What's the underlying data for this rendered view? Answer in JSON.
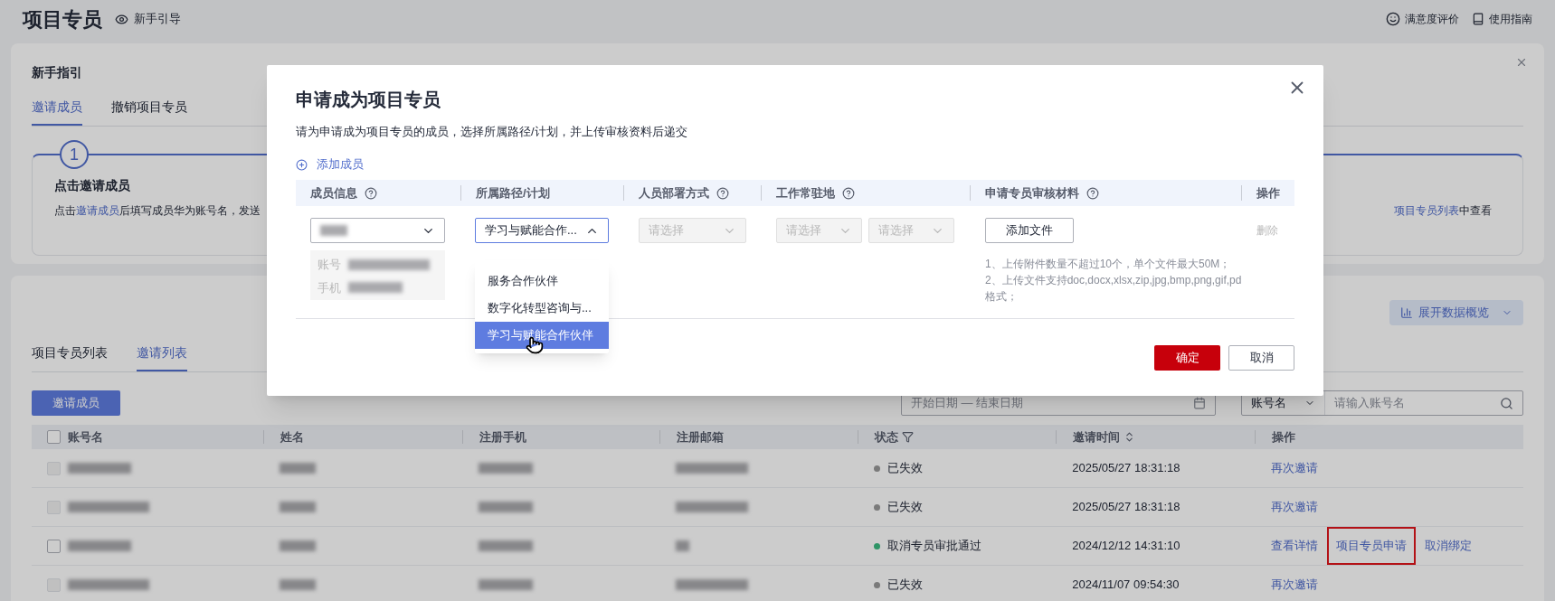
{
  "header": {
    "title": "项目专员",
    "guide_link": "新手引导",
    "right_links": [
      {
        "kind": "smile",
        "label": "满意度评价"
      },
      {
        "kind": "book",
        "label": "使用指南"
      }
    ]
  },
  "guide_card": {
    "title": "新手指引",
    "tabs": [
      {
        "label": "邀请成员",
        "selected": true
      },
      {
        "label": "撤销项目专员",
        "selected": false
      }
    ],
    "step": {
      "number": "1",
      "title": "点击邀请成员",
      "desc_before": "点击",
      "desc_link": "邀请成员",
      "desc_after": "后填写成员华为账号名，发送",
      "tail_link": "项目专员列表",
      "tail_after": "中查看"
    }
  },
  "list_card": {
    "overview_button": "展开数据概览",
    "tabs": [
      {
        "label": "项目专员列表",
        "selected": false
      },
      {
        "label": "邀请列表",
        "selected": true
      }
    ],
    "invite_button": "邀请成员",
    "date_range": {
      "placeholder": "开始日期 — 结束日期"
    },
    "search_type": "账号名",
    "search": {
      "placeholder": "请输入账号名"
    },
    "columns": [
      {
        "label": "账号名",
        "kind": "checkbox",
        "checked": false
      },
      {
        "label": "姓名",
        "kind": "plain"
      },
      {
        "label": "注册手机",
        "kind": "plain"
      },
      {
        "label": "注册邮箱",
        "kind": "plain"
      },
      {
        "label": "状态",
        "kind": "filter"
      },
      {
        "label": "邀请时间",
        "kind": "sort"
      },
      {
        "label": "操作",
        "kind": "plain"
      }
    ],
    "rows": [
      {
        "checkbox_disabled": true,
        "status": "已失效",
        "color": "#7a7a7a",
        "time": "2025/05/27 18:31:18",
        "actions": [
          {
            "label": "再次邀请",
            "highlighted": false
          }
        ]
      },
      {
        "checkbox_disabled": true,
        "status": "已失效",
        "color": "#7a7a7a",
        "time": "2025/05/27 18:31:18",
        "actions": [
          {
            "label": "再次邀请",
            "highlighted": false
          }
        ]
      },
      {
        "checkbox_disabled": false,
        "status": "取消专员审批通过",
        "color": "#2f9466",
        "time": "2024/12/12 14:31:10",
        "actions": [
          {
            "label": "查看详情",
            "highlighted": false
          },
          {
            "label": "项目专员申请",
            "highlighted": true
          },
          {
            "label": "取消绑定",
            "highlighted": false
          }
        ]
      },
      {
        "checkbox_disabled": true,
        "status": "已失效",
        "color": "#7a7a7a",
        "time": "2024/11/07 09:54:30",
        "actions": [
          {
            "label": "再次邀请",
            "highlighted": false
          }
        ]
      }
    ]
  },
  "dialog": {
    "title": "申请成为项目专员",
    "subtitle": "请为申请成为项目专员的成员，选择所属路径/计划，并上传审核资料后递交",
    "add_member": "添加成员",
    "columns": [
      {
        "label": "成员信息",
        "kind": "help"
      },
      {
        "label": "所属路径/计划",
        "kind": "plain"
      },
      {
        "label": "人员部署方式",
        "kind": "help"
      },
      {
        "label": "工作常驻地",
        "kind": "help"
      },
      {
        "label": "申请专员审核材料",
        "kind": "help"
      },
      {
        "label": "操作",
        "kind": "plain"
      }
    ],
    "row": {
      "account_label": "账号",
      "phone_label": "手机",
      "path_select": {
        "value": "学习与赋能合作...",
        "open": true,
        "options": [
          {
            "label": "服务合作伙伴",
            "selected": false
          },
          {
            "label": "数字化转型咨询与...",
            "selected": false
          },
          {
            "label": "学习与赋能合作伙伴",
            "selected": true
          }
        ]
      },
      "deploy_select": {
        "placeholder": "请选择",
        "disabled": true
      },
      "location_selects": [
        {
          "placeholder": "请选择",
          "disabled": true
        },
        {
          "placeholder": "请选择",
          "disabled": true
        }
      ],
      "add_file": "添加文件",
      "hints": [
        "1、上传附件数量不超过10个，单个文件最大50M；",
        "2、上传文件支持doc,docx,xlsx,zip,jpg,bmp,png,gif,pd",
        "格式；"
      ],
      "delete": "删除"
    },
    "buttons": [
      {
        "label": "确定",
        "kind": "primary"
      },
      {
        "label": "取消",
        "kind": "secondary"
      }
    ]
  }
}
